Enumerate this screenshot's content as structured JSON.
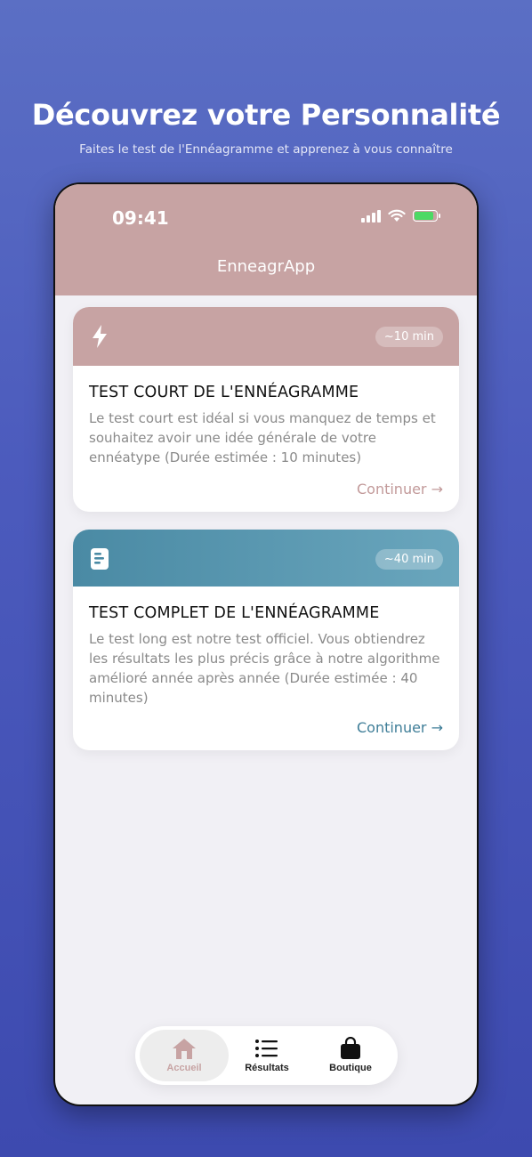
{
  "hero": {
    "title": "Découvrez votre Personnalité",
    "subtitle": "Faites le test de l'Ennéagramme et apprenez à vous connaître"
  },
  "status_bar": {
    "time": "09:41"
  },
  "header": {
    "app_title": "EnneagrApp"
  },
  "cards": [
    {
      "icon": "lightning-bolt-icon",
      "duration_badge": "~10 min",
      "title": "TEST COURT DE L'ENNÉAGRAMME",
      "description": "Le test court est idéal si vous manquez de temps et souhaitez avoir une idée générale de votre ennéatype (Durée estimée : 10 minutes)",
      "link_label": "Continuer →"
    },
    {
      "icon": "document-icon",
      "duration_badge": "~40 min",
      "title": "TEST COMPLET DE L'ENNÉAGRAMME",
      "description": "Le test long est notre test officiel. Vous obtiendrez les résultats les plus précis grâce à notre algorithme amélioré année après année (Durée estimée : 40 minutes)",
      "link_label": "Continuer →"
    }
  ],
  "tabbar": {
    "items": [
      {
        "label": "Accueil",
        "icon": "home-icon",
        "active": true
      },
      {
        "label": "Résultats",
        "icon": "list-icon",
        "active": false
      },
      {
        "label": "Boutique",
        "icon": "shopping-bag-icon",
        "active": false
      }
    ]
  },
  "colors": {
    "primary_rose": "#c7a3a3",
    "teal": "#4a8aa4",
    "background_blue": "#4c5bbd"
  }
}
